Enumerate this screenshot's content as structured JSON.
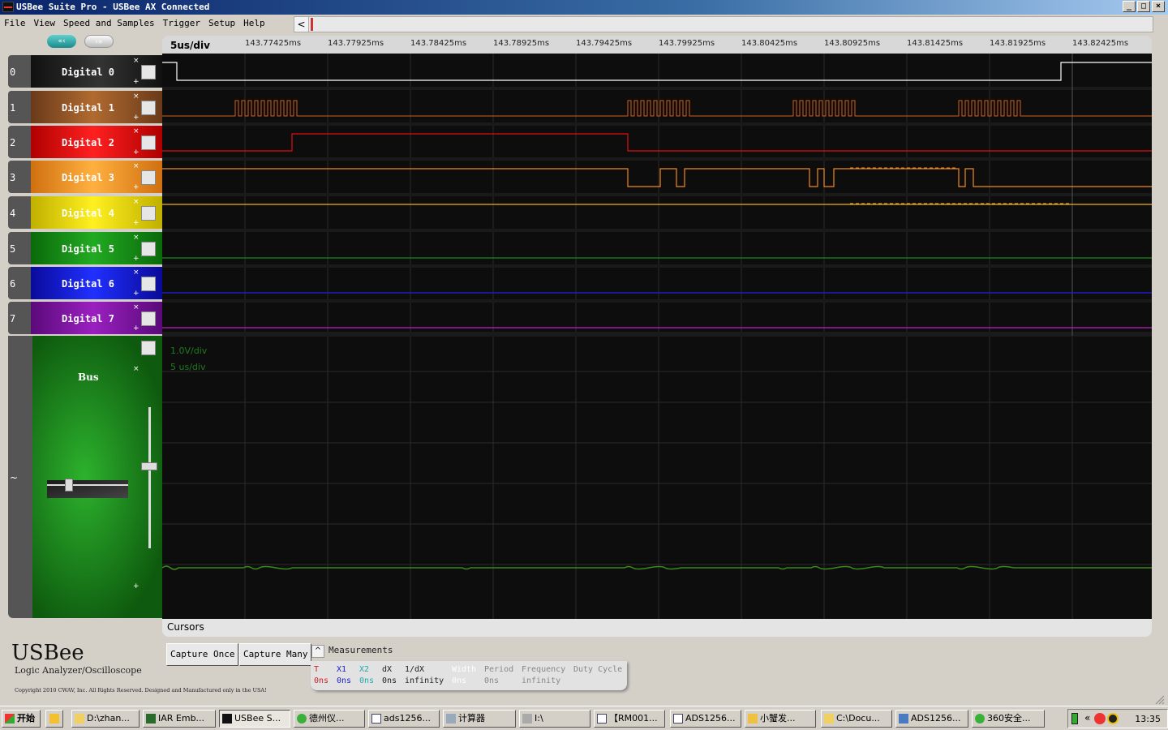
{
  "window": {
    "title": "USBee Suite Pro - USBee AX Connected",
    "min": "_",
    "max": "□",
    "close": "×"
  },
  "menu": [
    "File",
    "View",
    "Speed and Samples",
    "Trigger",
    "Setup",
    "Help"
  ],
  "scroll": {
    "left_arrow": "<"
  },
  "nav": {
    "back": "«‹",
    "forward": "›»"
  },
  "timebar": {
    "scale": "5us/div",
    "ticks": [
      "143.77425ms",
      "143.77925ms",
      "143.78425ms",
      "143.78925ms",
      "143.79425ms",
      "143.79925ms",
      "143.80425ms",
      "143.80925ms",
      "143.81425ms",
      "143.81925ms",
      "143.82425ms"
    ]
  },
  "channels": [
    {
      "num": "0",
      "name": "Digital 0",
      "color": "#ffffff",
      "bg": "#1a1a1a"
    },
    {
      "num": "1",
      "name": "Digital 1",
      "color": "#d0601a",
      "bg": "#8a4a20"
    },
    {
      "num": "2",
      "name": "Digital 2",
      "color": "#e01010",
      "bg": "#d01010"
    },
    {
      "num": "3",
      "name": "Digital 3",
      "color": "#f08a20",
      "bg": "#f09020"
    },
    {
      "num": "4",
      "name": "Digital 4",
      "color": "#f0b020",
      "bg": "#e0d010"
    },
    {
      "num": "5",
      "name": "Digital 5",
      "color": "#1a8a1a",
      "bg": "#1a8a1a"
    },
    {
      "num": "6",
      "name": "Digital 6",
      "color": "#2020e0",
      "bg": "#1010c0"
    },
    {
      "num": "7",
      "name": "Digital 7",
      "color": "#c020c0",
      "bg": "#8a1aa0"
    }
  ],
  "channel_marks": {
    "x": "×",
    "plus": "+"
  },
  "bus": {
    "label": "Bus",
    "tilde": "~",
    "volts_div": "1.0V/div",
    "time_div": "5 us/div"
  },
  "cursors": {
    "label": "Cursors"
  },
  "brand": {
    "logo": "USBee",
    "subtitle": "Logic Analyzer/Oscilloscope",
    "copyright": "Copyright 2010 CWAV, Inc. All Rights Reserved. Designed and Manufactured only in the USA!"
  },
  "buttons": {
    "capture_once": "Capture Once",
    "capture_many": "Capture Many"
  },
  "measurements": {
    "title": "Measurements",
    "collapse": "^",
    "cols": [
      {
        "h": "T",
        "v": "0ns",
        "color": "#cc2222"
      },
      {
        "h": "X1",
        "v": "0ns",
        "color": "#2222cc"
      },
      {
        "h": "X2",
        "v": "0ns",
        "color": "#22aaaa"
      },
      {
        "h": "dX",
        "v": "0ns",
        "color": "#222"
      },
      {
        "h": "1/dX",
        "v": "infinity",
        "color": "#222"
      },
      {
        "h": "Width",
        "v": "0ns",
        "color": "#fff"
      },
      {
        "h": "Period",
        "v": "0ns",
        "color": "#888"
      },
      {
        "h": "Frequency",
        "v": "infinity",
        "color": "#888"
      },
      {
        "h": "Duty Cycle",
        "v": "",
        "color": "#888"
      }
    ]
  },
  "taskbar": {
    "start": "开始",
    "items": [
      "D:\\zhan...",
      "IAR Emb...",
      "USBee S...",
      "德州仪...",
      "ads1256...",
      "计算器",
      "I:\\",
      "【RM001...",
      "ADS1256...",
      "小蟹发...",
      "C:\\Docu...",
      "ADS1256...",
      "360安全..."
    ],
    "tray_arrow": "«",
    "clock": "13:35"
  }
}
